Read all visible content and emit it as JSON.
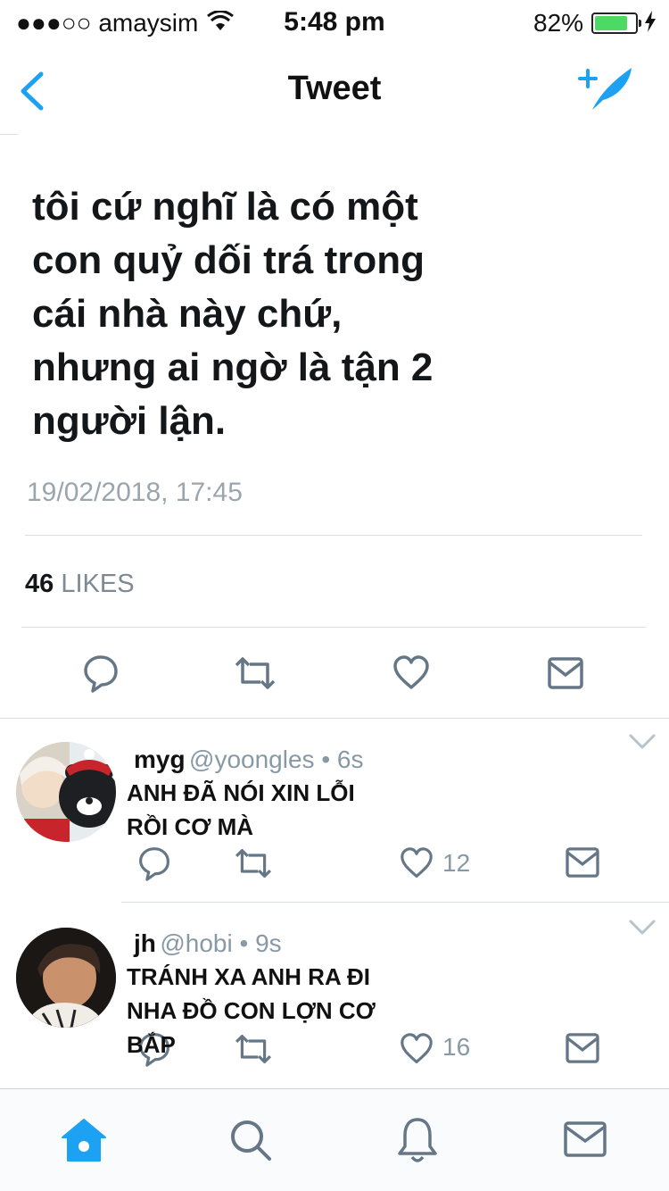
{
  "status": {
    "carrier": "●●●○○ amaysim",
    "time": "5:48 pm",
    "battery": "82%",
    "battery_level": 0.82
  },
  "nav": {
    "title": "Tweet"
  },
  "tweet": {
    "text": "tôi cứ nghĩ là có một\ncon quỷ dối trá trong\ncái nhà này chứ,\nnhưng ai ngờ là tận 2\nngười lận.",
    "date": "19/02/2018, 17:45",
    "likes_count": "46",
    "likes_label": "LIKES"
  },
  "replies": [
    {
      "name": "myg",
      "handle": "@yoongles • 6s",
      "text": "ANH ĐÃ NÓI XIN LỖI\nRỒI CƠ MÀ",
      "likes": "12"
    },
    {
      "name": "jh",
      "handle": "@hobi • 9s",
      "text": "TRÁNH XA ANH RA ĐI\nNHA ĐỒ CON LỢN CƠ\nBẮP",
      "likes": "16"
    }
  ],
  "colors": {
    "accent": "#1da1f2",
    "icon": "#657786",
    "divider": "#d8dde1"
  },
  "icons": [
    "back-chevron",
    "compose-quill",
    "reply",
    "retweet",
    "heart",
    "message",
    "home",
    "search",
    "bell",
    "mail"
  ]
}
